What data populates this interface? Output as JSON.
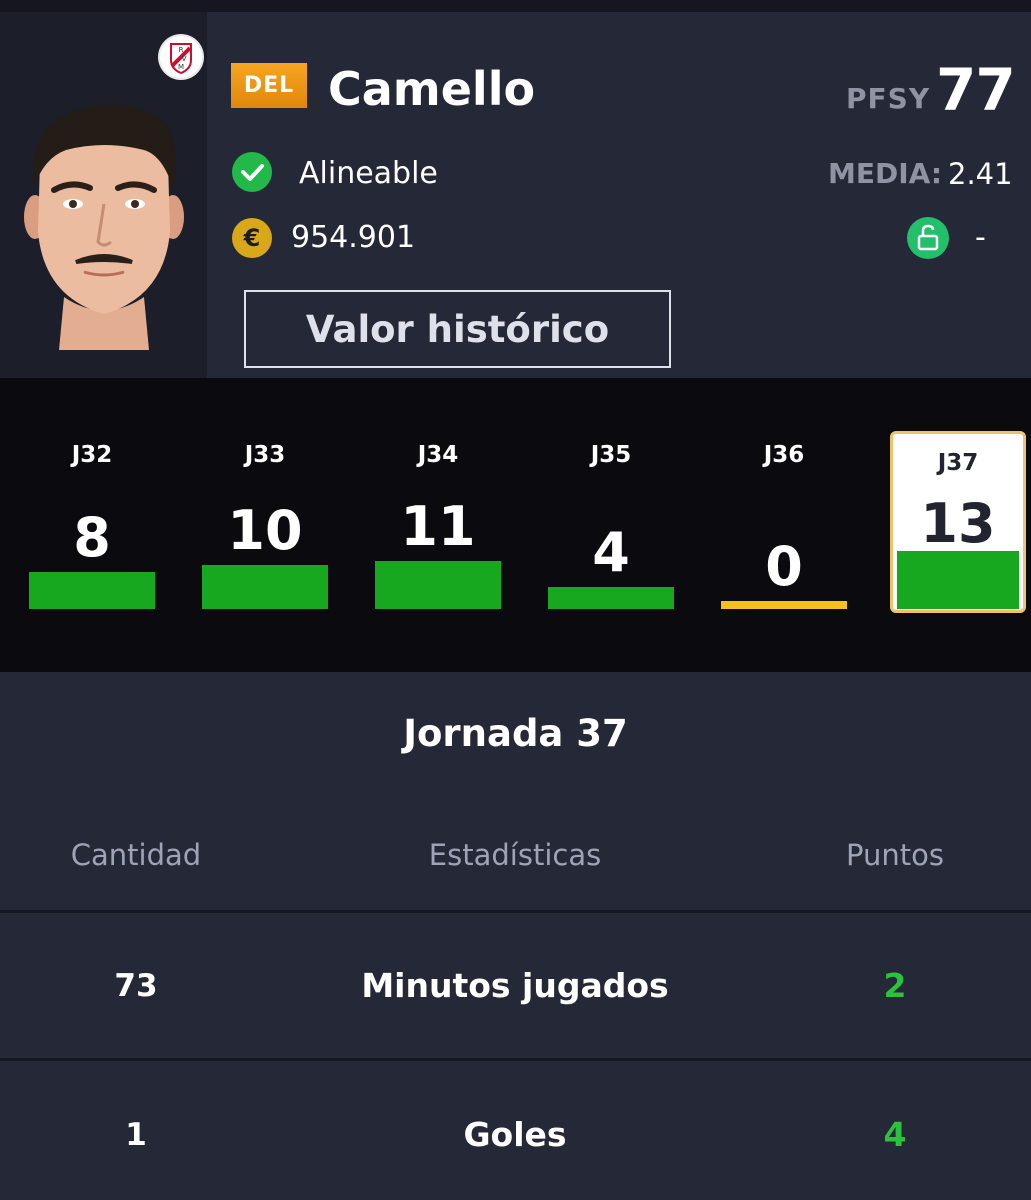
{
  "player": {
    "position": "DEL",
    "name": "Camello",
    "pfsy_label": "PFSY",
    "pfsy_value": "77",
    "status": "Alineable",
    "media_label": "MEDIA:",
    "media_value": "2.41",
    "currency_symbol": "€",
    "price": "954.901",
    "clause": "-",
    "history_button": "Valor histórico"
  },
  "matchdays": [
    {
      "label": "J32",
      "points": "8",
      "score": 8,
      "bar_color": "#18a81f"
    },
    {
      "label": "J33",
      "points": "10",
      "score": 10,
      "bar_color": "#18a81f"
    },
    {
      "label": "J34",
      "points": "11",
      "score": 11,
      "bar_color": "#18a81f"
    },
    {
      "label": "J35",
      "points": "4",
      "score": 4,
      "bar_color": "#18a81f"
    },
    {
      "label": "J36",
      "points": "0",
      "score": 0,
      "bar_color": "#f2c21a"
    },
    {
      "label": "J37",
      "points": "13",
      "score": 13,
      "bar_color": "#18a81f",
      "selected": true
    }
  ],
  "detail": {
    "title": "Jornada 37",
    "headers": {
      "qty": "Cantidad",
      "stat": "Estadísticas",
      "pts": "Puntos"
    },
    "rows": [
      {
        "qty": "73",
        "stat": "Minutos jugados",
        "pts": "2"
      },
      {
        "qty": "1",
        "stat": "Goles",
        "pts": "4"
      }
    ]
  },
  "colors": {
    "background": "#252836",
    "matchday_strip": "#0b0b0f",
    "positive": "#2cc33c",
    "position_badge": "#f0960f"
  }
}
